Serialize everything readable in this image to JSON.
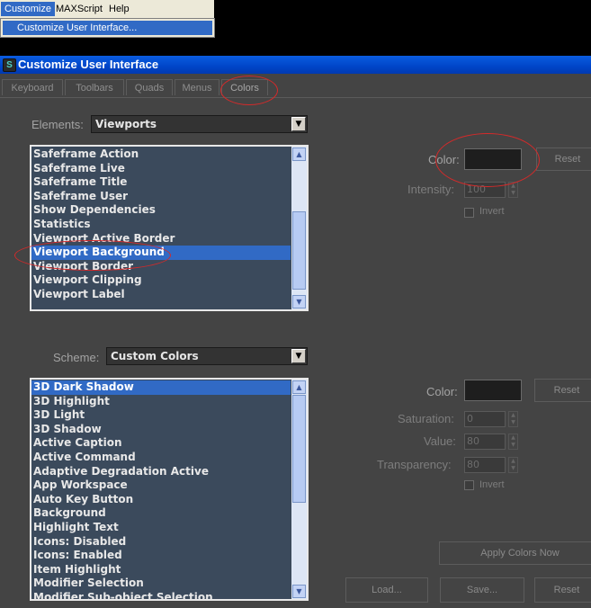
{
  "menubar": {
    "items": [
      {
        "label": "Customize"
      },
      {
        "label": "MAXScript"
      },
      {
        "label": "Help"
      }
    ]
  },
  "dropdown": {
    "item": "Customize User Interface..."
  },
  "dialog": {
    "title": "Customize User Interface",
    "tabs": [
      {
        "label": "Keyboard"
      },
      {
        "label": "Toolbars"
      },
      {
        "label": "Quads"
      },
      {
        "label": "Menus"
      },
      {
        "label": "Colors"
      }
    ],
    "active_tab": "Colors"
  },
  "elements": {
    "label": "Elements:",
    "selected": "Viewports",
    "items": [
      "Safeframe Action",
      "Safeframe Live",
      "Safeframe Title",
      "Safeframe User",
      "Show Dependencies",
      "Statistics",
      "Viewport Active Border",
      "Viewport Background",
      "Viewport Border",
      "Viewport Clipping",
      "Viewport Label"
    ],
    "selected_item": "Viewport Background"
  },
  "element_color": {
    "color_label": "Color:",
    "reset_label": "Reset",
    "intensity_label": "Intensity:",
    "intensity_value": "100",
    "invert_label": "Invert",
    "swatch_color": "#1e1e1e"
  },
  "scheme": {
    "label": "Scheme:",
    "selected": "Custom Colors",
    "items": [
      "3D Dark Shadow",
      "3D Highlight",
      "3D Light",
      "3D Shadow",
      "Active Caption",
      "Active Command",
      "Adaptive Degradation Active",
      "App Workspace",
      "Auto Key Button",
      "Background",
      "Highlight Text",
      "Icons: Disabled",
      "Icons: Enabled",
      "Item Highlight",
      "Modifier Selection",
      "Modifier Sub-object Selection"
    ],
    "selected_item": "3D Dark Shadow"
  },
  "scheme_color": {
    "color_label": "Color:",
    "reset_label": "Reset",
    "saturation_label": "Saturation:",
    "saturation_value": "0",
    "value_label": "Value:",
    "value_value": "80",
    "transparency_label": "Transparency:",
    "transparency_value": "80",
    "invert_label": "Invert",
    "apply_label": "Apply Colors Now"
  },
  "footer": {
    "load_label": "Load...",
    "save_label": "Save...",
    "reset_label": "Reset"
  },
  "colors": {
    "selection": "#316ac5",
    "list_bg": "#3b4a5c",
    "dialog_bg": "#444444",
    "annotation": "#d42a2a"
  }
}
